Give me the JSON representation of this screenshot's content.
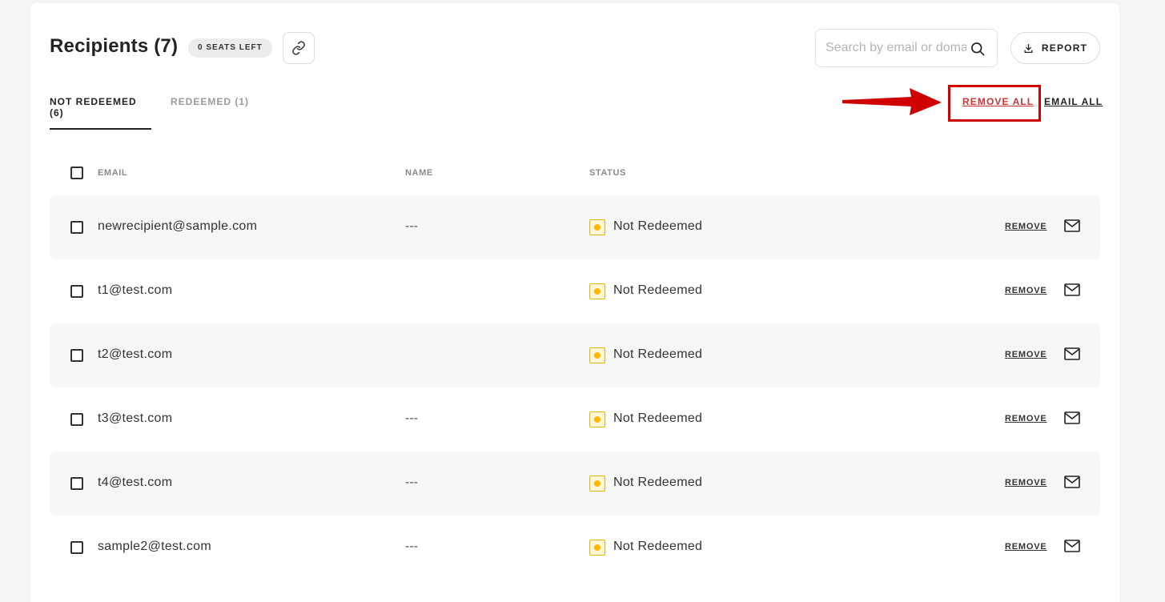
{
  "header": {
    "title": "Recipients (7)",
    "seats_badge": "0 SEATS LEFT",
    "search_placeholder": "Search by email or domain",
    "report_label": "REPORT"
  },
  "tabs": [
    {
      "label": "NOT REDEEMED (6)",
      "active": true
    },
    {
      "label": "REDEEMED (1)",
      "active": false
    }
  ],
  "actions": {
    "remove_all": "REMOVE ALL",
    "email_all": "EMAIL ALL"
  },
  "table": {
    "columns": [
      "EMAIL",
      "NAME",
      "STATUS"
    ],
    "rows": [
      {
        "email": "newrecipient@sample.com",
        "name": "---",
        "status": "Not Redeemed",
        "remove": "REMOVE"
      },
      {
        "email": "t1@test.com",
        "name": "",
        "status": "Not Redeemed",
        "remove": "REMOVE"
      },
      {
        "email": "t2@test.com",
        "name": "",
        "status": "Not Redeemed",
        "remove": "REMOVE"
      },
      {
        "email": "t3@test.com",
        "name": "---",
        "status": "Not Redeemed",
        "remove": "REMOVE"
      },
      {
        "email": "t4@test.com",
        "name": "---",
        "status": "Not Redeemed",
        "remove": "REMOVE"
      },
      {
        "email": "sample2@test.com",
        "name": "---",
        "status": "Not Redeemed",
        "remove": "REMOVE"
      }
    ]
  },
  "colors": {
    "highlight_box": "#d10000",
    "remove_all_text": "#d33030",
    "status_yellow": "#ffb800",
    "row_shade": "#f6f6f6"
  },
  "icons": [
    "link-icon",
    "search-icon",
    "download-icon",
    "arrow-annotation",
    "mail-icon"
  ]
}
